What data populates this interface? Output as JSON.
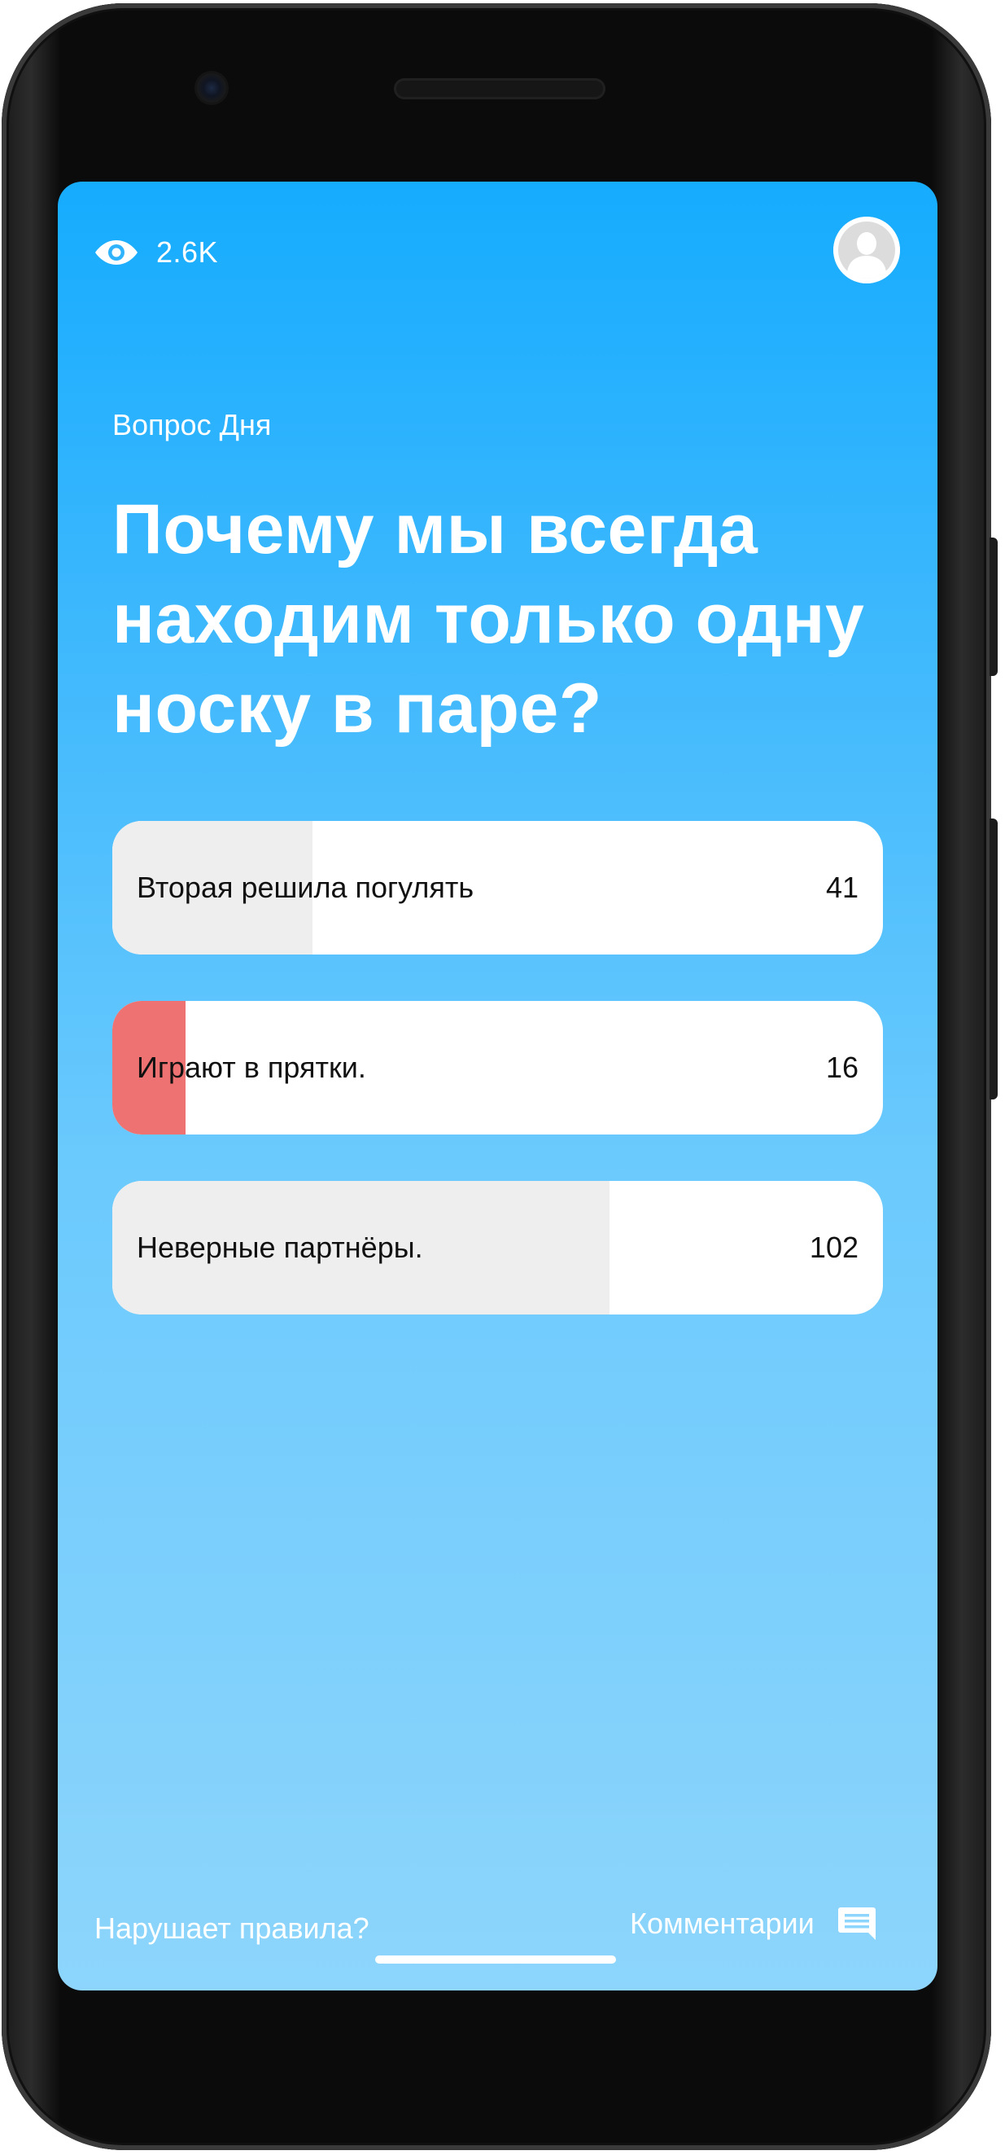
{
  "header": {
    "views_count": "2.6K",
    "views_icon": "eye-icon",
    "avatar_icon": "user-avatar-icon"
  },
  "poll": {
    "kicker": "Вопрос Дня",
    "question": "Почему мы всегда находим только одну носку в паре?",
    "options": [
      {
        "label": "Вторая решила погулять",
        "votes": "41",
        "fill_fraction": 0.26,
        "selected": false
      },
      {
        "label": "Играют в прятки.",
        "votes": "16",
        "fill_fraction": 0.095,
        "selected": true
      },
      {
        "label": "Неверные партнёры.",
        "votes": "102",
        "fill_fraction": 0.645,
        "selected": false
      }
    ]
  },
  "footer": {
    "report_label": "Нарушает правила?",
    "comments_label": "Комментарии",
    "comments_icon": "comment-icon"
  },
  "colors": {
    "gradient_top": "#16acfe",
    "gradient_bottom": "#8dd5fc",
    "option_fill": "#eeeeee",
    "selected_fill": "#ee7272",
    "text_light": "#ffffff",
    "text_dark": "#111111"
  }
}
